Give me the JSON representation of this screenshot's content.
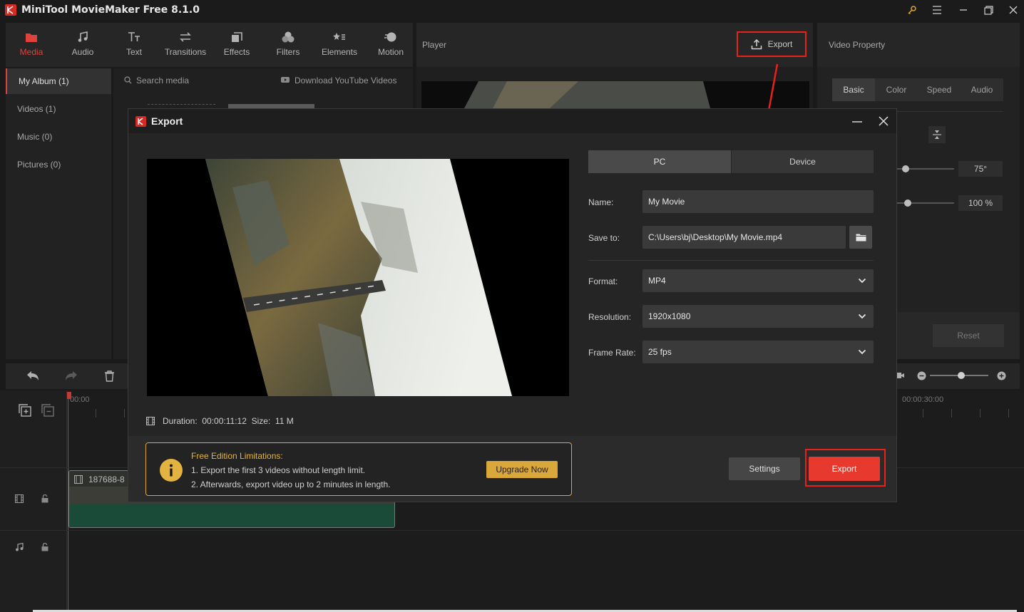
{
  "app": {
    "title": "MiniTool MovieMaker Free 8.1.0"
  },
  "toolbar": {
    "items": [
      {
        "label": "Media",
        "icon": "folder-icon"
      },
      {
        "label": "Audio",
        "icon": "music-note-icon"
      },
      {
        "label": "Text",
        "icon": "text-icon"
      },
      {
        "label": "Transitions",
        "icon": "transitions-icon"
      },
      {
        "label": "Effects",
        "icon": "effects-icon"
      },
      {
        "label": "Filters",
        "icon": "filters-icon"
      },
      {
        "label": "Elements",
        "icon": "elements-icon"
      },
      {
        "label": "Motion",
        "icon": "motion-icon"
      }
    ]
  },
  "sidebar": {
    "items": [
      {
        "label": "My Album (1)"
      },
      {
        "label": "Videos (1)"
      },
      {
        "label": "Music (0)"
      },
      {
        "label": "Pictures (0)"
      }
    ]
  },
  "media": {
    "search_placeholder": "Search media",
    "download_label": "Download YouTube Videos"
  },
  "player": {
    "label": "Player",
    "export_label": "Export"
  },
  "video_property": {
    "title": "Video Property",
    "tabs": [
      "Basic",
      "Color",
      "Speed",
      "Audio"
    ],
    "rotation_value": "75°",
    "scale_value": "100 %",
    "reset_label": "Reset"
  },
  "timeline": {
    "time_start": "00:00",
    "time_mark": "00:00:30:00",
    "clip_name": "187688-8"
  },
  "dialog": {
    "title": "Export",
    "tabs": {
      "pc": "PC",
      "device": "Device"
    },
    "name_label": "Name:",
    "name_value": "My Movie",
    "save_label": "Save to:",
    "save_value": "C:\\Users\\bj\\Desktop\\My Movie.mp4",
    "format_label": "Format:",
    "format_value": "MP4",
    "resolution_label": "Resolution:",
    "resolution_value": "1920x1080",
    "framerate_label": "Frame Rate:",
    "framerate_value": "25 fps",
    "duration_label": "Duration:",
    "duration_value": "00:00:11:12",
    "size_label": "Size:",
    "size_value": "11 M",
    "limit_title": "Free Edition Limitations:",
    "limit_line1": "1. Export the first 3 videos without length limit.",
    "limit_line2": "2. Afterwards, export video up to 2 minutes in length.",
    "upgrade_label": "Upgrade Now",
    "settings_label": "Settings",
    "export_label": "Export"
  },
  "colors": {
    "accent_red": "#e0413a",
    "export_button": "#e8392f",
    "upgrade_gold": "#d9a73a",
    "highlight_red": "#e8221b"
  }
}
